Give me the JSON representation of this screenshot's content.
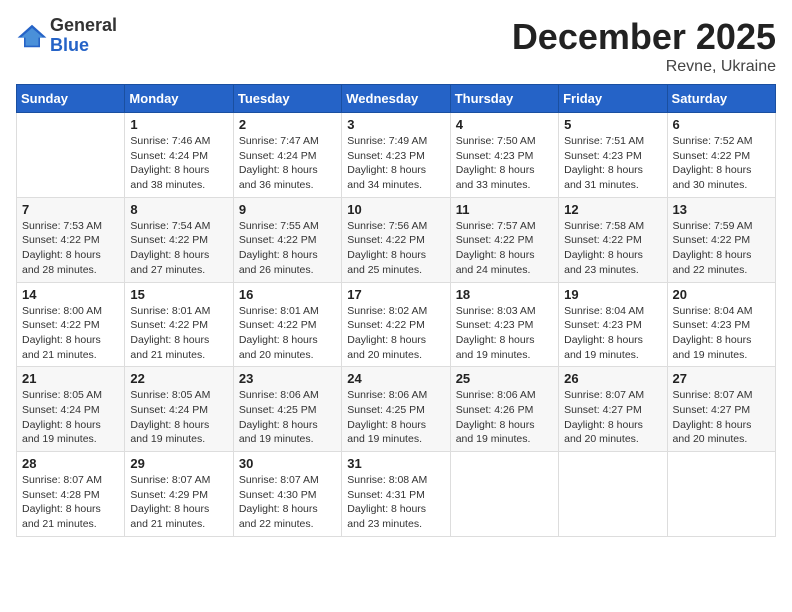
{
  "header": {
    "logo_general": "General",
    "logo_blue": "Blue",
    "month_title": "December 2025",
    "location": "Revne, Ukraine"
  },
  "weekdays": [
    "Sunday",
    "Monday",
    "Tuesday",
    "Wednesday",
    "Thursday",
    "Friday",
    "Saturday"
  ],
  "weeks": [
    [
      {
        "day": "",
        "sunrise": "",
        "sunset": "",
        "daylight": ""
      },
      {
        "day": "1",
        "sunrise": "Sunrise: 7:46 AM",
        "sunset": "Sunset: 4:24 PM",
        "daylight": "Daylight: 8 hours and 38 minutes."
      },
      {
        "day": "2",
        "sunrise": "Sunrise: 7:47 AM",
        "sunset": "Sunset: 4:24 PM",
        "daylight": "Daylight: 8 hours and 36 minutes."
      },
      {
        "day": "3",
        "sunrise": "Sunrise: 7:49 AM",
        "sunset": "Sunset: 4:23 PM",
        "daylight": "Daylight: 8 hours and 34 minutes."
      },
      {
        "day": "4",
        "sunrise": "Sunrise: 7:50 AM",
        "sunset": "Sunset: 4:23 PM",
        "daylight": "Daylight: 8 hours and 33 minutes."
      },
      {
        "day": "5",
        "sunrise": "Sunrise: 7:51 AM",
        "sunset": "Sunset: 4:23 PM",
        "daylight": "Daylight: 8 hours and 31 minutes."
      },
      {
        "day": "6",
        "sunrise": "Sunrise: 7:52 AM",
        "sunset": "Sunset: 4:22 PM",
        "daylight": "Daylight: 8 hours and 30 minutes."
      }
    ],
    [
      {
        "day": "7",
        "sunrise": "Sunrise: 7:53 AM",
        "sunset": "Sunset: 4:22 PM",
        "daylight": "Daylight: 8 hours and 28 minutes."
      },
      {
        "day": "8",
        "sunrise": "Sunrise: 7:54 AM",
        "sunset": "Sunset: 4:22 PM",
        "daylight": "Daylight: 8 hours and 27 minutes."
      },
      {
        "day": "9",
        "sunrise": "Sunrise: 7:55 AM",
        "sunset": "Sunset: 4:22 PM",
        "daylight": "Daylight: 8 hours and 26 minutes."
      },
      {
        "day": "10",
        "sunrise": "Sunrise: 7:56 AM",
        "sunset": "Sunset: 4:22 PM",
        "daylight": "Daylight: 8 hours and 25 minutes."
      },
      {
        "day": "11",
        "sunrise": "Sunrise: 7:57 AM",
        "sunset": "Sunset: 4:22 PM",
        "daylight": "Daylight: 8 hours and 24 minutes."
      },
      {
        "day": "12",
        "sunrise": "Sunrise: 7:58 AM",
        "sunset": "Sunset: 4:22 PM",
        "daylight": "Daylight: 8 hours and 23 minutes."
      },
      {
        "day": "13",
        "sunrise": "Sunrise: 7:59 AM",
        "sunset": "Sunset: 4:22 PM",
        "daylight": "Daylight: 8 hours and 22 minutes."
      }
    ],
    [
      {
        "day": "14",
        "sunrise": "Sunrise: 8:00 AM",
        "sunset": "Sunset: 4:22 PM",
        "daylight": "Daylight: 8 hours and 21 minutes."
      },
      {
        "day": "15",
        "sunrise": "Sunrise: 8:01 AM",
        "sunset": "Sunset: 4:22 PM",
        "daylight": "Daylight: 8 hours and 21 minutes."
      },
      {
        "day": "16",
        "sunrise": "Sunrise: 8:01 AM",
        "sunset": "Sunset: 4:22 PM",
        "daylight": "Daylight: 8 hours and 20 minutes."
      },
      {
        "day": "17",
        "sunrise": "Sunrise: 8:02 AM",
        "sunset": "Sunset: 4:22 PM",
        "daylight": "Daylight: 8 hours and 20 minutes."
      },
      {
        "day": "18",
        "sunrise": "Sunrise: 8:03 AM",
        "sunset": "Sunset: 4:23 PM",
        "daylight": "Daylight: 8 hours and 19 minutes."
      },
      {
        "day": "19",
        "sunrise": "Sunrise: 8:04 AM",
        "sunset": "Sunset: 4:23 PM",
        "daylight": "Daylight: 8 hours and 19 minutes."
      },
      {
        "day": "20",
        "sunrise": "Sunrise: 8:04 AM",
        "sunset": "Sunset: 4:23 PM",
        "daylight": "Daylight: 8 hours and 19 minutes."
      }
    ],
    [
      {
        "day": "21",
        "sunrise": "Sunrise: 8:05 AM",
        "sunset": "Sunset: 4:24 PM",
        "daylight": "Daylight: 8 hours and 19 minutes."
      },
      {
        "day": "22",
        "sunrise": "Sunrise: 8:05 AM",
        "sunset": "Sunset: 4:24 PM",
        "daylight": "Daylight: 8 hours and 19 minutes."
      },
      {
        "day": "23",
        "sunrise": "Sunrise: 8:06 AM",
        "sunset": "Sunset: 4:25 PM",
        "daylight": "Daylight: 8 hours and 19 minutes."
      },
      {
        "day": "24",
        "sunrise": "Sunrise: 8:06 AM",
        "sunset": "Sunset: 4:25 PM",
        "daylight": "Daylight: 8 hours and 19 minutes."
      },
      {
        "day": "25",
        "sunrise": "Sunrise: 8:06 AM",
        "sunset": "Sunset: 4:26 PM",
        "daylight": "Daylight: 8 hours and 19 minutes."
      },
      {
        "day": "26",
        "sunrise": "Sunrise: 8:07 AM",
        "sunset": "Sunset: 4:27 PM",
        "daylight": "Daylight: 8 hours and 20 minutes."
      },
      {
        "day": "27",
        "sunrise": "Sunrise: 8:07 AM",
        "sunset": "Sunset: 4:27 PM",
        "daylight": "Daylight: 8 hours and 20 minutes."
      }
    ],
    [
      {
        "day": "28",
        "sunrise": "Sunrise: 8:07 AM",
        "sunset": "Sunset: 4:28 PM",
        "daylight": "Daylight: 8 hours and 21 minutes."
      },
      {
        "day": "29",
        "sunrise": "Sunrise: 8:07 AM",
        "sunset": "Sunset: 4:29 PM",
        "daylight": "Daylight: 8 hours and 21 minutes."
      },
      {
        "day": "30",
        "sunrise": "Sunrise: 8:07 AM",
        "sunset": "Sunset: 4:30 PM",
        "daylight": "Daylight: 8 hours and 22 minutes."
      },
      {
        "day": "31",
        "sunrise": "Sunrise: 8:08 AM",
        "sunset": "Sunset: 4:31 PM",
        "daylight": "Daylight: 8 hours and 23 minutes."
      },
      {
        "day": "",
        "sunrise": "",
        "sunset": "",
        "daylight": ""
      },
      {
        "day": "",
        "sunrise": "",
        "sunset": "",
        "daylight": ""
      },
      {
        "day": "",
        "sunrise": "",
        "sunset": "",
        "daylight": ""
      }
    ]
  ]
}
